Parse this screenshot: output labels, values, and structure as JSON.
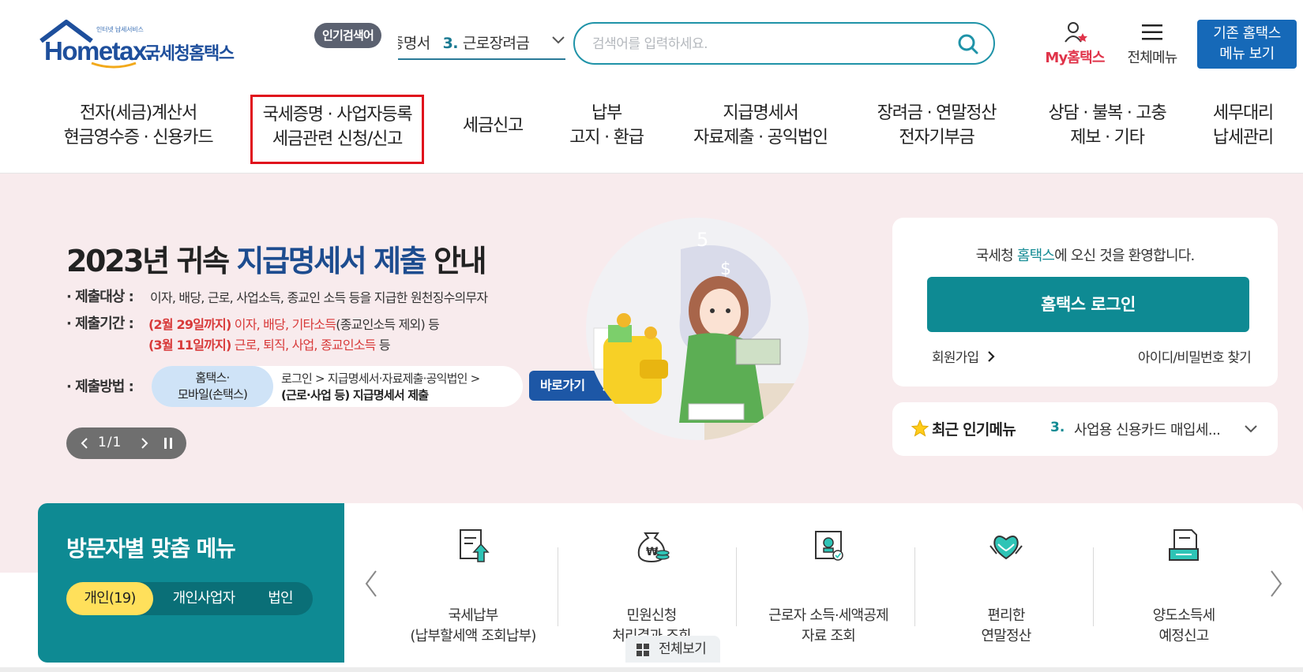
{
  "header": {
    "logo_small": "인터넷 납세서비스",
    "logo_word": "Hometax.",
    "logo_kor": "국세청홈택스",
    "popular_badge": "인기검색어",
    "ticker_prev": "증명서",
    "ticker_num": "3.",
    "ticker_text": "근로장려금",
    "search_placeholder": "검색어를 입력하세요.",
    "my_hometax": "My홈택스",
    "all_menu": "전체메뉴",
    "old_btn_line1": "기존 홈택스",
    "old_btn_line2": "메뉴 보기"
  },
  "gnb": [
    {
      "line1": "전자(세금)계산서",
      "line2": "현금영수증 · 신용카드"
    },
    {
      "line1": "국세증명 · 사업자등록",
      "line2": "세금관련 신청/신고"
    },
    {
      "line1": "세금신고",
      "line2": ""
    },
    {
      "line1": "납부",
      "line2": "고지 · 환급"
    },
    {
      "line1": "지급명세서",
      "line2": "자료제출 · 공익법인"
    },
    {
      "line1": "장려금 · 연말정산",
      "line2": "전자기부금"
    },
    {
      "line1": "상담 · 불복 · 고충",
      "line2": "제보 · 기타"
    },
    {
      "line1": "세무대리",
      "line2": "납세관리"
    }
  ],
  "banner": {
    "title_a": "2023년 귀속 ",
    "title_hl": "지급명세서 제출",
    "title_b": " 안내",
    "target_label": "· 제출대상 :",
    "target_text": "이자, 배당, 근로, 사업소득, 종교인 소득 등을 지급한 원천징수의무자",
    "period_label": "· 제출기간 :",
    "period1_date": "(2월 29일까지)",
    "period1_red": " 이자, 배당, 기타소득",
    "period1_rest": "(종교인소득 제외) 등",
    "period2_date": "(3월 11일까지)",
    "period2_red": " 근로, 퇴직, 사업, 종교인소득",
    "period2_rest": " 등",
    "method_label": "· 제출방법 :",
    "method_pill1": "홈택스·",
    "method_pill2": "모바일(손택스)",
    "method_line1": "로그인 > 지급명세서·자료제출·공익법인 >",
    "method_line2": "(근로·사업 등) 지급명세서 제출",
    "go_btn": "바로가기",
    "pager": "1/1"
  },
  "login": {
    "welcome_a": "국세청 ",
    "welcome_hl": "홈택스",
    "welcome_b": "에 오신 것을 환영합니다.",
    "login_btn": "홈택스 로그인",
    "join": "회원가입",
    "find": "아이디/비밀번호 찾기"
  },
  "popular_menu": {
    "title": "최근 인기메뉴",
    "num": "3.",
    "text": "사업용 신용카드 매입세..."
  },
  "visitor": {
    "title": "방문자별 맞춤 메뉴",
    "tabs": [
      "개인(19)",
      "개인사업자",
      "법인"
    ]
  },
  "quick": [
    {
      "icon": "tax-payment-icon",
      "line1": "국세납부",
      "line2": "(납부할세액 조회납부)"
    },
    {
      "icon": "money-bag-icon",
      "line1": "민원신청",
      "line2": "처리결과 조회"
    },
    {
      "icon": "document-seal-icon",
      "line1": "근로자 소득·세액공제",
      "line2": "자료 조회"
    },
    {
      "icon": "heart-hands-icon",
      "line1": "편리한",
      "line2": "연말정산"
    },
    {
      "icon": "transfer-tax-icon",
      "line1": "양도소득세",
      "line2": "예정신고"
    }
  ],
  "view_all": "전체보기",
  "colors": {
    "teal": "#0e8a93",
    "brand_blue": "#1e4f9c",
    "hero_bg": "#f8ebed",
    "highlight_red": "#e0101c",
    "yellow_tab": "#ffe05b"
  }
}
